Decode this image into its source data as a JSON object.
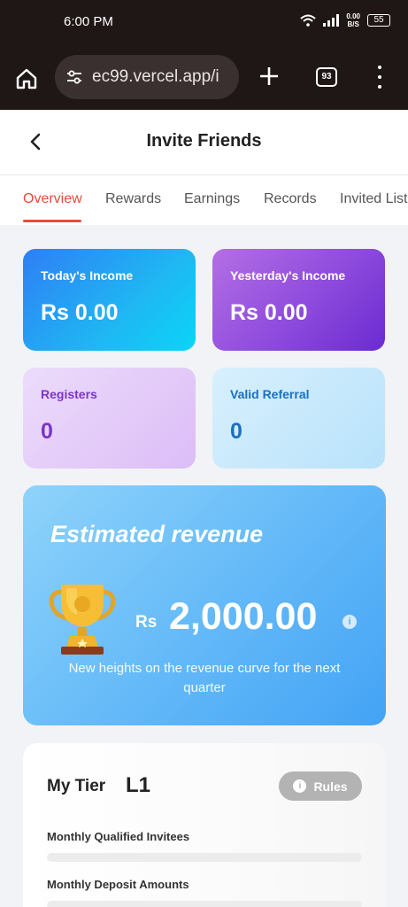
{
  "status_bar": {
    "time": "6:00 PM",
    "speed_value": "0.00",
    "speed_unit": "B/S",
    "battery": "55"
  },
  "browser": {
    "url": "ec99.vercel.app/i",
    "tab_count": "93"
  },
  "header": {
    "title": "Invite Friends"
  },
  "tabs": [
    {
      "label": "Overview",
      "active": true
    },
    {
      "label": "Rewards",
      "active": false
    },
    {
      "label": "Earnings",
      "active": false
    },
    {
      "label": "Records",
      "active": false
    },
    {
      "label": "Invited List",
      "active": false
    }
  ],
  "stats": {
    "today": {
      "label": "Today's Income",
      "value": "Rs 0.00"
    },
    "yesterday": {
      "label": "Yesterday's Income",
      "value": "Rs 0.00"
    },
    "registers": {
      "label": "Registers",
      "value": "0"
    },
    "valid_referral": {
      "label": "Valid Referral",
      "value": "0"
    }
  },
  "estimated": {
    "title": "Estimated revenue",
    "currency": "Rs",
    "amount": "2,000.00",
    "description": "New heights on the revenue curve for the next quarter"
  },
  "tier": {
    "label": "My Tier",
    "level": "L1",
    "rules_label": "Rules",
    "metrics": [
      {
        "label": "Monthly Qualified Invitees",
        "progress": 0
      },
      {
        "label": "Monthly Deposit Amounts",
        "progress": 0
      }
    ]
  },
  "colors": {
    "accent": "#e84a3c",
    "chrome": "#1f1716"
  },
  "icons": [
    "home-icon",
    "site-settings-icon",
    "plus-icon",
    "tab-switcher-icon",
    "more-vert-icon",
    "back-arrow-icon",
    "trophy-icon",
    "info-icon"
  ]
}
